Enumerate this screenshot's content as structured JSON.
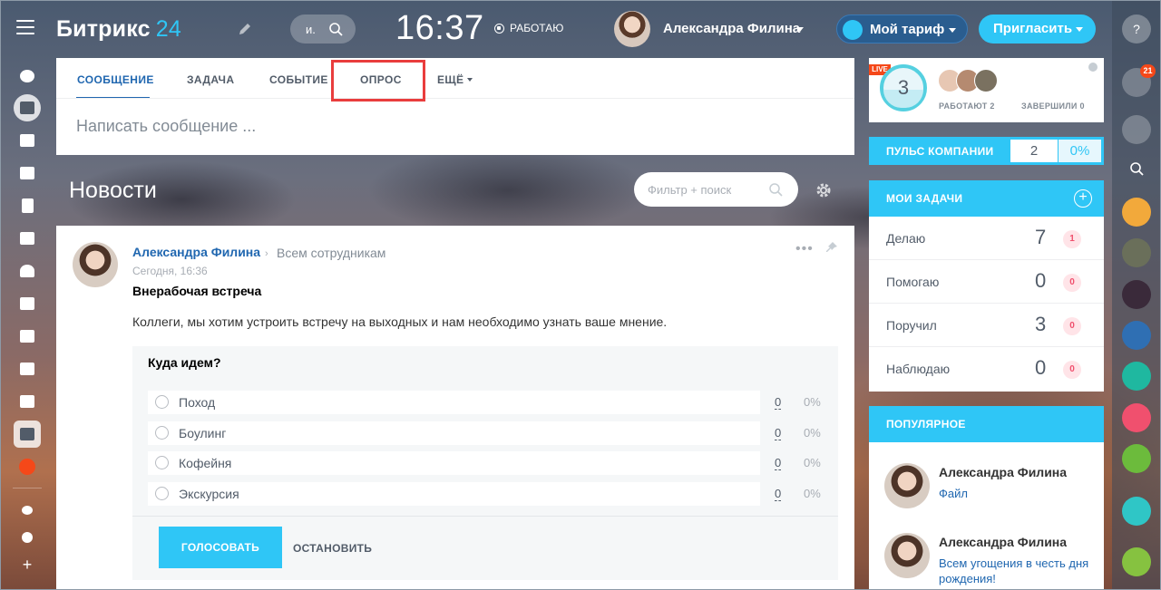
{
  "header": {
    "logo_main": "Битрикс",
    "logo_num": "24",
    "search_text": "и.",
    "clock": "16:37",
    "work_status": "РАБОТАЮ",
    "user_name": "Александра Филина",
    "tariff_label": "Мой тариф",
    "invite_label": "Пригласить"
  },
  "composer": {
    "tabs": [
      {
        "label": "СООБЩЕНИЕ"
      },
      {
        "label": "ЗАДАЧА"
      },
      {
        "label": "СОБЫТИЕ"
      },
      {
        "label": "ОПРОС"
      },
      {
        "label": "ЕЩЁ"
      }
    ],
    "placeholder": "Написать сообщение ..."
  },
  "news": {
    "title": "Новости",
    "filter_placeholder": "Фильтр + поиск"
  },
  "post": {
    "author": "Александра Филина",
    "target": "Всем сотрудникам",
    "time": "Сегодня, 16:36",
    "title": "Внерабочая встреча",
    "text": "Коллеги, мы хотим устроить встречу на выходных и нам необходимо узнать ваше мнение.",
    "vote": {
      "question": "Куда идем?",
      "answers": [
        {
          "label": "Поход",
          "count": "0",
          "pct": "0%"
        },
        {
          "label": "Боулинг",
          "count": "0",
          "pct": "0%"
        },
        {
          "label": "Кофейня",
          "count": "0",
          "pct": "0%"
        },
        {
          "label": "Экскурсия",
          "count": "0",
          "pct": "0%"
        }
      ],
      "vote_label": "ГОЛОСОВАТЬ",
      "stop_label": "ОСТАНОВИТЬ"
    }
  },
  "live": {
    "badge": "LIVE",
    "count": "3",
    "working_label": "РАБОТАЮТ",
    "working_count": "2",
    "done_label": "ЗАВЕРШИЛИ",
    "done_count": "0"
  },
  "pulse": {
    "label": "ПУЛЬС КОМПАНИИ",
    "value": "2",
    "percent": "0%"
  },
  "tasks": {
    "title": "МОИ ЗАДАЧИ",
    "rows": [
      {
        "label": "Делаю",
        "count": "7",
        "badge": "1"
      },
      {
        "label": "Помогаю",
        "count": "0",
        "badge": "0"
      },
      {
        "label": "Поручил",
        "count": "3",
        "badge": "0"
      },
      {
        "label": "Наблюдаю",
        "count": "0",
        "badge": "0"
      }
    ]
  },
  "popular": {
    "title": "ПОПУЛЯРНОЕ",
    "items": [
      {
        "name": "Александра Филина",
        "link": "Файл"
      },
      {
        "name": "Александра Филина",
        "link": "Всем угощения в честь дня рождения!"
      }
    ]
  },
  "right_bar": {
    "notifications_badge": "21"
  },
  "colors": {
    "accent": "#2fc6f6",
    "link": "#2067b0",
    "highlight": "#e93d3d",
    "badge_red": "#f54819"
  }
}
